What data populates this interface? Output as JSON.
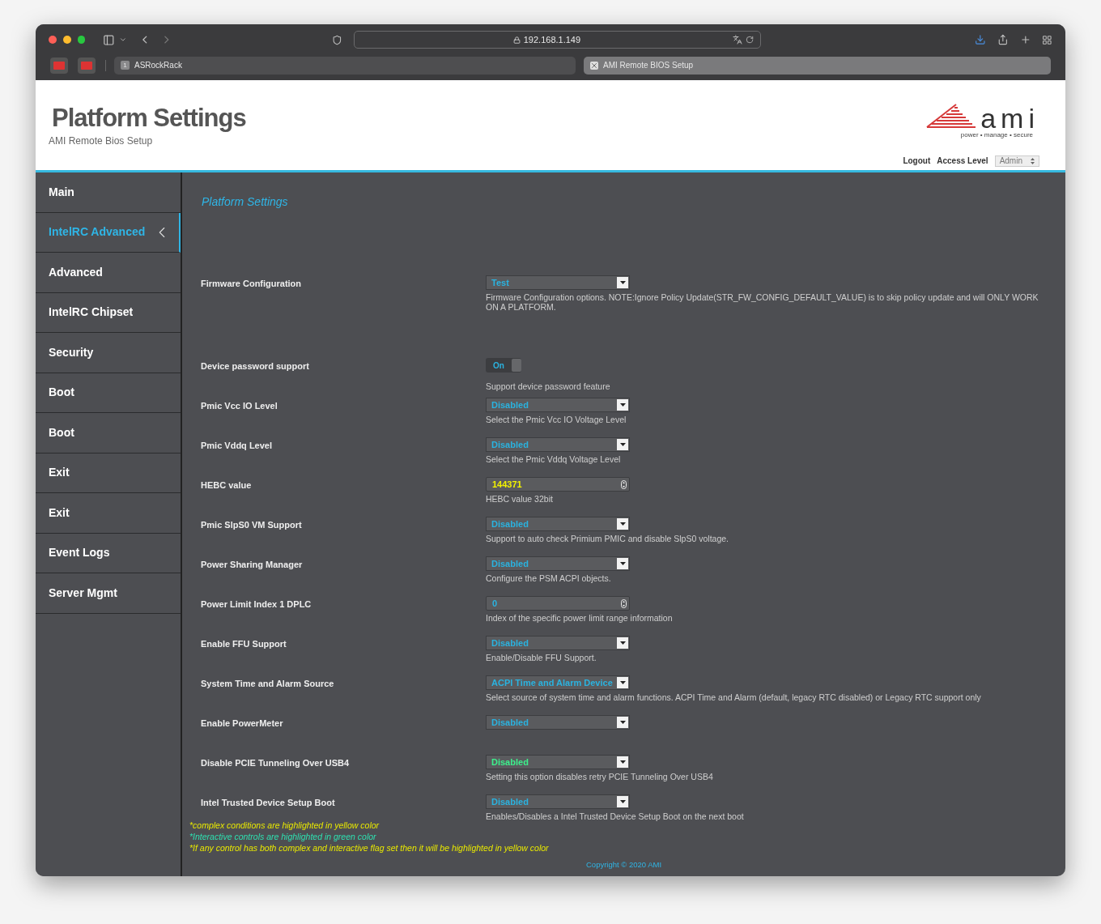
{
  "browser": {
    "address": "192.168.1.149",
    "tabs": [
      {
        "number": "1",
        "title": "ASRockRack",
        "selected": false
      },
      {
        "title": "AMI Remote BIOS Setup",
        "selected": true
      }
    ]
  },
  "header": {
    "title": "Platform Settings",
    "subtitle": "AMI Remote Bios Setup",
    "logo_word": "ami",
    "logo_tagline": "power • manage • secure",
    "logout": "Logout",
    "access_level_label": "Access Level",
    "access_level": "Admin"
  },
  "sidebar": {
    "items": [
      {
        "label": "Main",
        "selected": false
      },
      {
        "label": "IntelRC Advanced",
        "selected": true
      },
      {
        "label": "Advanced",
        "selected": false
      },
      {
        "label": "IntelRC Chipset",
        "selected": false
      },
      {
        "label": "Security",
        "selected": false
      },
      {
        "label": "Boot",
        "selected": false
      },
      {
        "label": "Boot",
        "selected": false
      },
      {
        "label": "Exit",
        "selected": false
      },
      {
        "label": "Exit",
        "selected": false
      },
      {
        "label": "Event Logs",
        "selected": false
      },
      {
        "label": "Server Mgmt",
        "selected": false
      }
    ]
  },
  "page_title": "Platform Settings",
  "settings": [
    {
      "label": "Firmware Configuration",
      "kind": "select",
      "value": "Test",
      "color": "#2ab3e0",
      "help": "Firmware Configuration options. NOTE:Ignore Policy Update(STR_FW_CONFIG_DEFAULT_VALUE) is to skip policy update and will ONLY WORK ON A PLATFORM."
    },
    {
      "label": "Device password support",
      "kind": "toggle",
      "value": "On",
      "on": true,
      "color": "#2ab3e0",
      "help": "Support device password feature"
    },
    {
      "label": "Pmic Vcc IO Level",
      "kind": "select",
      "value": "Disabled",
      "color": "#2ab3e0",
      "help": "Select the Pmic Vcc IO Voltage Level"
    },
    {
      "label": "Pmic Vddq Level",
      "kind": "select",
      "value": "Disabled",
      "color": "#2ab3e0",
      "help": "Select the Pmic Vddq Voltage Level"
    },
    {
      "label": "HEBC value",
      "kind": "number",
      "value": "144371",
      "color": "#f2f200",
      "help": "HEBC value 32bit"
    },
    {
      "label": "Pmic SlpS0 VM Support",
      "kind": "select",
      "value": "Disabled",
      "color": "#2ab3e0",
      "help": "Support to auto check Primium PMIC and disable SlpS0 voltage."
    },
    {
      "label": "Power Sharing Manager",
      "kind": "select",
      "value": "Disabled",
      "color": "#2ab3e0",
      "help": "Configure the PSM ACPI objects."
    },
    {
      "label": "Power Limit Index 1 DPLC",
      "kind": "number",
      "value": "0",
      "color": "#2ab3e0",
      "help": "Index of the specific power limit range information"
    },
    {
      "label": "Enable FFU Support",
      "kind": "select",
      "value": "Disabled",
      "color": "#2ab3e0",
      "help": "Enable/Disable FFU Support."
    },
    {
      "label": "System Time and Alarm Source",
      "kind": "select",
      "value": "ACPI Time and Alarm Device",
      "color": "#2ab3e0",
      "help": "Select source of system time and alarm functions. ACPI Time and Alarm (default, legacy RTC disabled) or Legacy RTC support only"
    },
    {
      "label": "Enable PowerMeter",
      "kind": "select",
      "value": "Disabled",
      "color": "#2ab3e0"
    },
    {
      "label": "Disable PCIE Tunneling Over USB4",
      "kind": "select",
      "value": "Disabled",
      "color": "#3cf08c",
      "help": "Setting this option disables retry PCIE Tunneling Over USB4"
    },
    {
      "label": "Intel Trusted Device Setup Boot",
      "kind": "select",
      "value": "Disabled",
      "color": "#2ab3e0",
      "help": "Enables/Disables a Intel Trusted Device Setup Boot on the next boot"
    }
  ],
  "notes": [
    {
      "text": "*complex conditions are highlighted in yellow color",
      "color": "#e8e800"
    },
    {
      "text": "*Interactive controls are highlighted in green color",
      "color": "#2ee0b0"
    },
    {
      "text": "*If any control has both complex and interactive flag set then it will be highlighted in yellow color",
      "color": "#e8e800"
    }
  ],
  "copyright": "Copyright © 2020 AMI"
}
